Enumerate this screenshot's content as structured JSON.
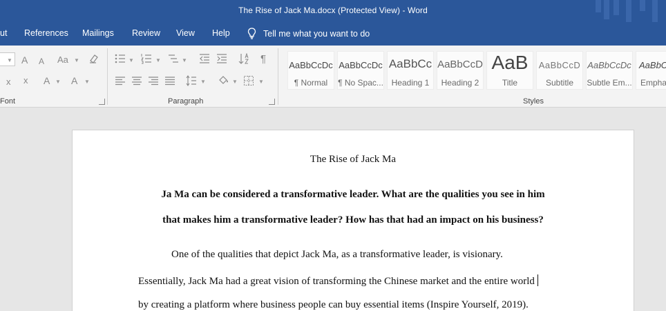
{
  "window": {
    "title": "The Rise of Jack Ma.docx (Protected View)  -  Word"
  },
  "tabs": [
    {
      "label": "ut"
    },
    {
      "label": "References"
    },
    {
      "label": "Mailings"
    },
    {
      "label": "Review"
    },
    {
      "label": "View"
    },
    {
      "label": "Help"
    }
  ],
  "tell_me": {
    "placeholder": "Tell me what you want to do",
    "icon": "lightbulb-icon"
  },
  "ribbon": {
    "groups": {
      "font": "Font",
      "paragraph": "Paragraph",
      "styles": "Styles"
    },
    "font_buttons": {
      "grow": "A",
      "shrink": "A",
      "case": "Aa",
      "subscript": "x",
      "superscript": "x",
      "highlight": "A",
      "color": "A"
    },
    "paragraph_buttons": {
      "show_marks": "¶"
    }
  },
  "styles": [
    {
      "sample": "AaBbCcDc",
      "name": "¶ Normal"
    },
    {
      "sample": "AaBbCcDc",
      "name": "¶ No Spac..."
    },
    {
      "sample": "AaBbCc",
      "name": "Heading 1"
    },
    {
      "sample": "AaBbCcD",
      "name": "Heading 2"
    },
    {
      "sample": "AaB",
      "name": "Title"
    },
    {
      "sample": "AaBbCcD",
      "name": "Subtitle"
    },
    {
      "sample": "AaBbCcDc",
      "name": "Subtle Em..."
    },
    {
      "sample": "AaBbCcDc",
      "name": "Empha"
    }
  ],
  "document": {
    "title": "The Rise of Jack Ma",
    "question_line1": "Ja Ma can be considered a transformative leader. What are the qualities you see in him",
    "question_line2": "that makes him a transformative leader? How has that had an impact on his business?",
    "body_line1": "One of the qualities that depict Jack Ma, as a transformative leader, is visionary.",
    "body_line2": "Essentially, Jack Ma had a great vision of transforming the Chinese market and the entire world",
    "body_line3": "by creating a platform where business people can buy essential items (Inspire Yourself, 2019)."
  },
  "colors": {
    "accent": "#2b579a",
    "ribbon": "#f3f3f3",
    "canvas": "#e6e6e6"
  }
}
